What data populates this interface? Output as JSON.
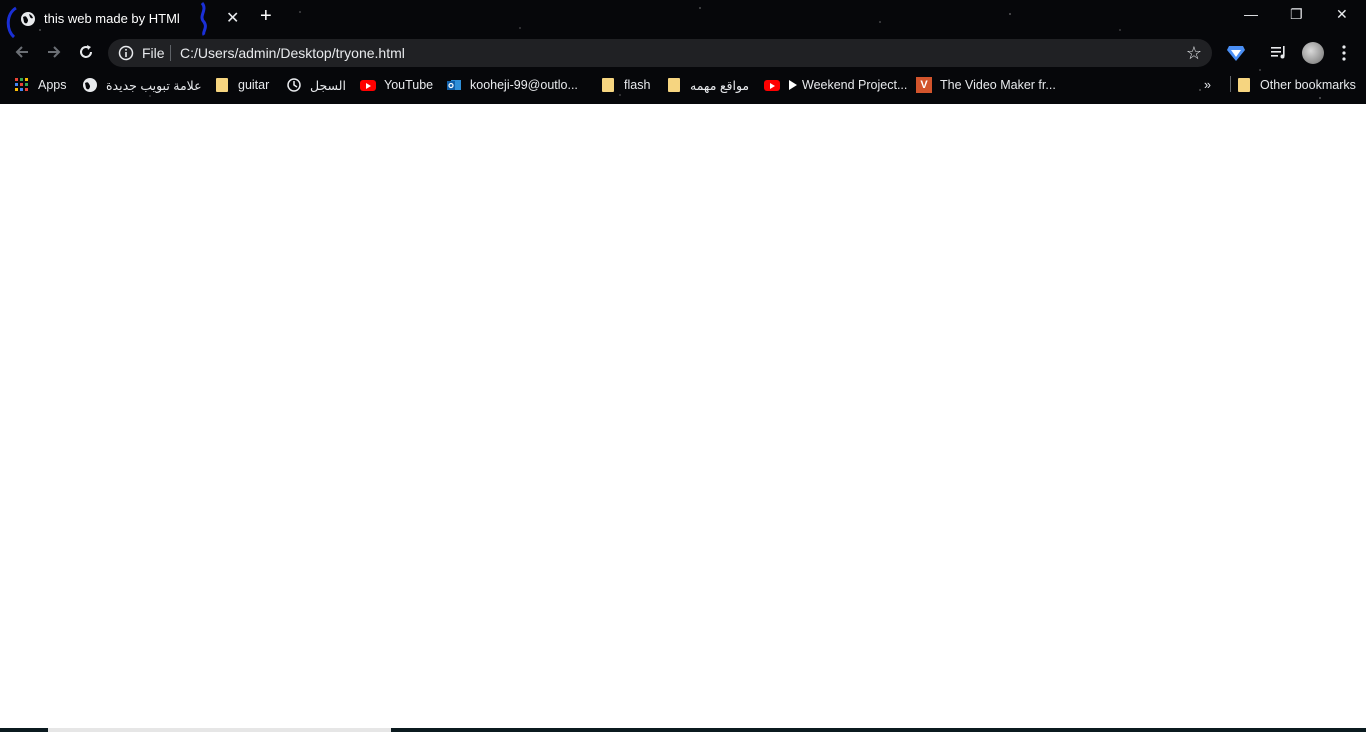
{
  "tab": {
    "title": "this web made by HTMl",
    "close": "✕"
  },
  "new_tab": "+",
  "window": {
    "minimize": "—",
    "restore": "❐",
    "close": "✕"
  },
  "omnibox": {
    "chip": "File",
    "url": "C:/Users/admin/Desktop/tryone.html"
  },
  "bookmarks": {
    "apps": "Apps",
    "items": [
      "علامة تبويب جديدة",
      "guitar",
      "السجل",
      "YouTube",
      "kooheji-99@outlo...",
      "flash",
      "مواقع مهمه",
      "Weekend Project...",
      "The Video Maker fr..."
    ],
    "overflow": "»",
    "other": "Other bookmarks"
  },
  "colors": {
    "chrome_bg": "#06070a",
    "omnibox_bg": "#202124",
    "folder": "#f6d580",
    "youtube": "#ff0000"
  }
}
